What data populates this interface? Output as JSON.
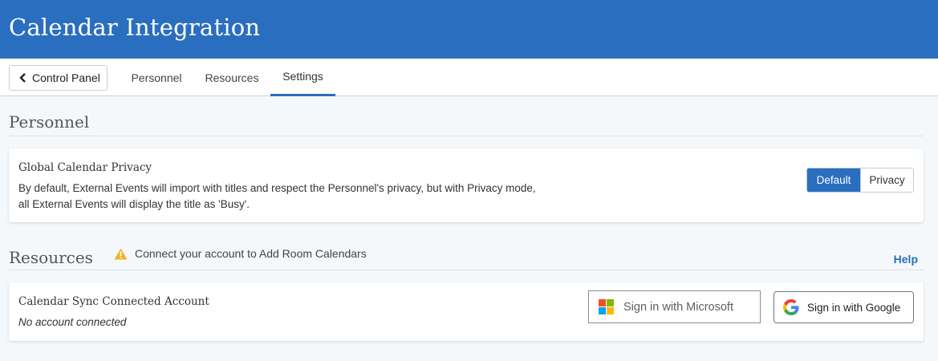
{
  "header": {
    "title": "Calendar Integration"
  },
  "nav": {
    "back_label": "Control Panel",
    "tabs": [
      {
        "label": "Personnel"
      },
      {
        "label": "Resources"
      },
      {
        "label": "Settings",
        "active": true
      }
    ]
  },
  "personnel": {
    "section_title": "Personnel",
    "card": {
      "title": "Global Calendar Privacy",
      "description": "By default, External Events will import with titles and respect the Personnel's privacy, but with Privacy mode, all External Events will display the title as 'Busy'.",
      "options": [
        "Default",
        "Privacy"
      ],
      "selected": "Default"
    }
  },
  "resources": {
    "section_title": "Resources",
    "warning": "Connect your account to Add Room Calendars",
    "help_label": "Help",
    "card": {
      "title": "Calendar Sync Connected Account",
      "status": "No account connected",
      "microsoft_label": "Sign in with Microsoft",
      "google_label": "Sign in with Google"
    }
  },
  "colors": {
    "brand": "#2a6ebf",
    "warning": "#f0b429",
    "ms_red": "#f25022",
    "ms_green": "#7fba00",
    "ms_blue": "#00a4ef",
    "ms_yellow": "#ffb900"
  },
  "icons": [
    "chevron-left-icon",
    "warning-icon",
    "microsoft-logo-icon",
    "google-logo-icon"
  ]
}
